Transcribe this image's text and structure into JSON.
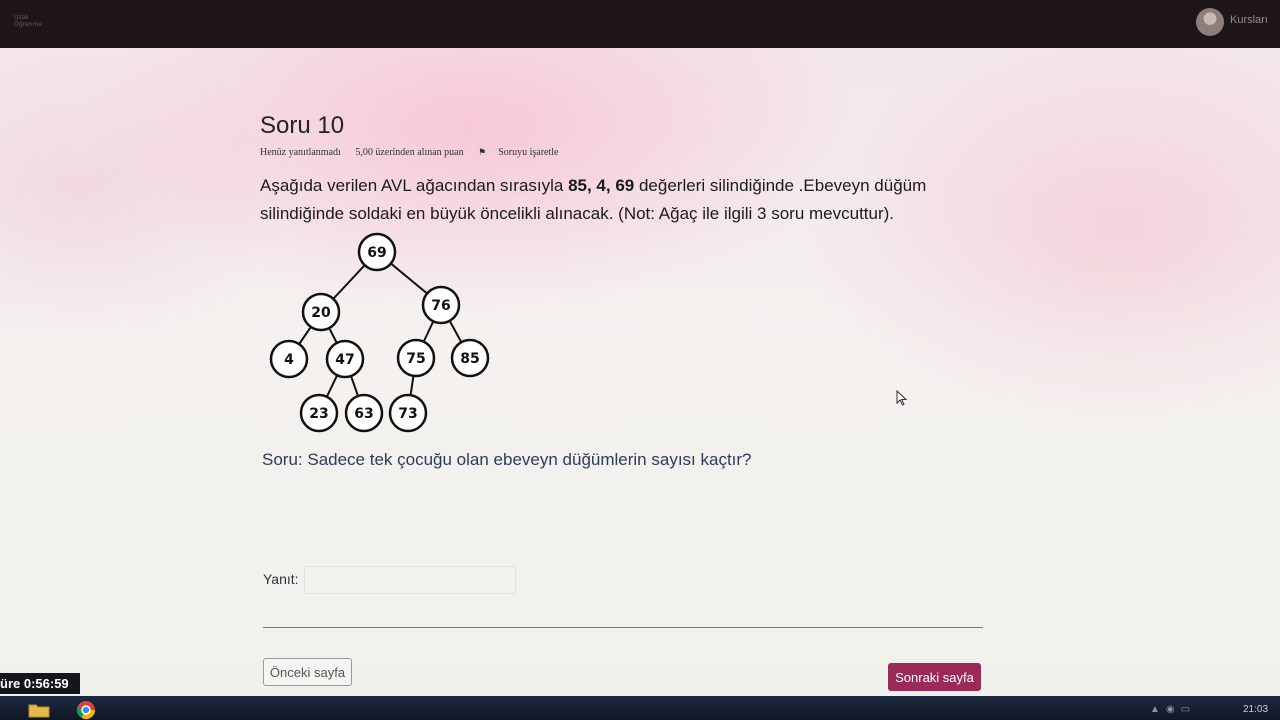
{
  "header": {
    "logo_line1": "Uzak",
    "logo_line2": "Öğrenme",
    "user_name": "Kursları"
  },
  "question": {
    "title": "Soru 10",
    "status": "Henüz yanıtlanmadı",
    "points": "5,00 üzerinden alınan puan",
    "flag_label": "Soruyu işaretle",
    "text_before": "Aşağıda verilen AVL ağacından sırasıyla ",
    "text_bold": "85, 4, 69",
    "text_after": " değerleri silindiğinde .Ebeveyn düğüm silindiğinde soldaki en büyük öncelikli alınacak. (Not: Ağaç ile ilgili 3 soru mevcuttur).",
    "ask": "Soru: Sadece tek çocuğu olan ebeveyn düğümlerin sayısı kaçtır?"
  },
  "tree": {
    "nodes": {
      "n69": "69",
      "n20": "20",
      "n76": "76",
      "n4": "4",
      "n47": "47",
      "n75": "75",
      "n85": "85",
      "n23": "23",
      "n63": "63",
      "n73": "73"
    }
  },
  "answer": {
    "label": "Yanıt:",
    "value": "",
    "placeholder": ""
  },
  "nav": {
    "prev_label": "Önceki sayfa",
    "next_label": "Sonraki sayfa"
  },
  "timer": {
    "text": "üre 0:56:59"
  },
  "taskbar": {
    "clock": "21:03",
    "tray_icons": [
      "network-icon",
      "volume-icon",
      "notification-icon"
    ]
  },
  "colors": {
    "accent": "#9b2a58",
    "question_ask": "#2d3a5a"
  }
}
